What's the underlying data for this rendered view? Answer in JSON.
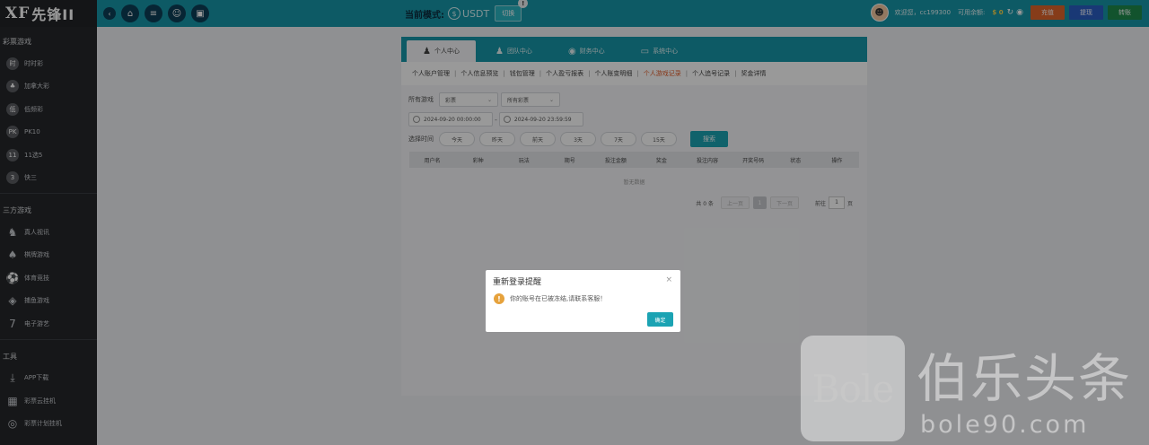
{
  "header": {
    "logo_mark": "XF",
    "logo_text": "先锋II",
    "round_buttons": [
      {
        "name": "back-icon",
        "glyph": "‹"
      },
      {
        "name": "home-icon",
        "glyph": "⌂"
      },
      {
        "name": "menu-icon",
        "glyph": "≡"
      },
      {
        "name": "user-card-icon",
        "glyph": "☺"
      },
      {
        "name": "gift-icon",
        "glyph": "▣"
      }
    ],
    "mode_label": "当前模式:",
    "mode_value": "USDT",
    "mode_coin_glyph": "$",
    "switch_label": "切换",
    "switch_badge": "!",
    "welcome": "欢迎您，cc199300",
    "balance_label": "可用余额:",
    "balance_value": "$ 0",
    "buttons": [
      {
        "label": "充值",
        "color": "#e0642a"
      },
      {
        "label": "提现",
        "color": "#2a5ec4"
      },
      {
        "label": "转账",
        "color": "#1f8a4c"
      }
    ]
  },
  "sidebar": {
    "sections": [
      {
        "title": "彩票游戏",
        "items": [
          {
            "label": "时时彩",
            "icon": "时"
          },
          {
            "label": "加拿大彩",
            "icon": "♣"
          },
          {
            "label": "低频彩",
            "icon": "低"
          },
          {
            "label": "PK10",
            "icon": "PK"
          },
          {
            "label": "11选5",
            "icon": "11"
          },
          {
            "label": "快三",
            "icon": "3"
          }
        ]
      },
      {
        "title": "三方游戏",
        "items": [
          {
            "label": "真人视讯",
            "icon": "♞"
          },
          {
            "label": "棋牌游戏",
            "icon": "♠"
          },
          {
            "label": "体育竞技",
            "icon": "⚽"
          },
          {
            "label": "捕鱼游戏",
            "icon": "◈"
          },
          {
            "label": "电子游艺",
            "icon": "7"
          }
        ]
      },
      {
        "title": "工具",
        "items": [
          {
            "label": "APP下载",
            "icon": "⤓"
          },
          {
            "label": "彩票云挂机",
            "icon": "▦"
          },
          {
            "label": "彩票计划挂机",
            "icon": "◎"
          }
        ]
      }
    ]
  },
  "tabs": [
    {
      "label": "个人中心",
      "icon": "♟",
      "active": true
    },
    {
      "label": "团队中心",
      "icon": "♟",
      "active": false
    },
    {
      "label": "财务中心",
      "icon": "◉",
      "active": false
    },
    {
      "label": "系统中心",
      "icon": "▭",
      "active": false
    }
  ],
  "subnav": [
    {
      "label": "个人账户管理",
      "active": false
    },
    {
      "label": "个人信息预览",
      "active": false
    },
    {
      "label": "钱包管理",
      "active": false
    },
    {
      "label": "个人盈亏报表",
      "active": false
    },
    {
      "label": "个人账变明细",
      "active": false
    },
    {
      "label": "个人游戏记录",
      "active": true
    },
    {
      "label": "个人追号记录",
      "active": false
    },
    {
      "label": "奖金详情",
      "active": false
    }
  ],
  "filters": {
    "game_label": "所有游戏",
    "select_category": "彩票",
    "select_lottery": "所有彩票",
    "date_start": "2024-09-20 00:00:00",
    "date_end": "2024-09-20 23:59:59",
    "date_sep": "-",
    "time_label": "选择时间",
    "quick_ranges": [
      "今天",
      "昨天",
      "前天",
      "3天",
      "7天",
      "15天"
    ],
    "search_label": "搜索"
  },
  "table": {
    "headers": [
      "用户名",
      "彩种",
      "玩法",
      "期号",
      "投注金额",
      "奖金",
      "投注内容",
      "开奖号码",
      "状态",
      "操作"
    ],
    "empty_text": "暂无数据"
  },
  "pagination": {
    "total": "共 0 条",
    "prev": "上一页",
    "current": "1",
    "next": "下一页",
    "goto_label": "前往",
    "goto_value": "1",
    "page_unit": "页"
  },
  "modal": {
    "title": "重新登录提醒",
    "close_glyph": "×",
    "icon_glyph": "!",
    "message": "你的账号在已被冻结,请联系客服！",
    "confirm_label": "确定"
  },
  "watermark": {
    "box_text": "Bole",
    "cn_text": "伯乐头条",
    "url_text": "bole90.com"
  }
}
